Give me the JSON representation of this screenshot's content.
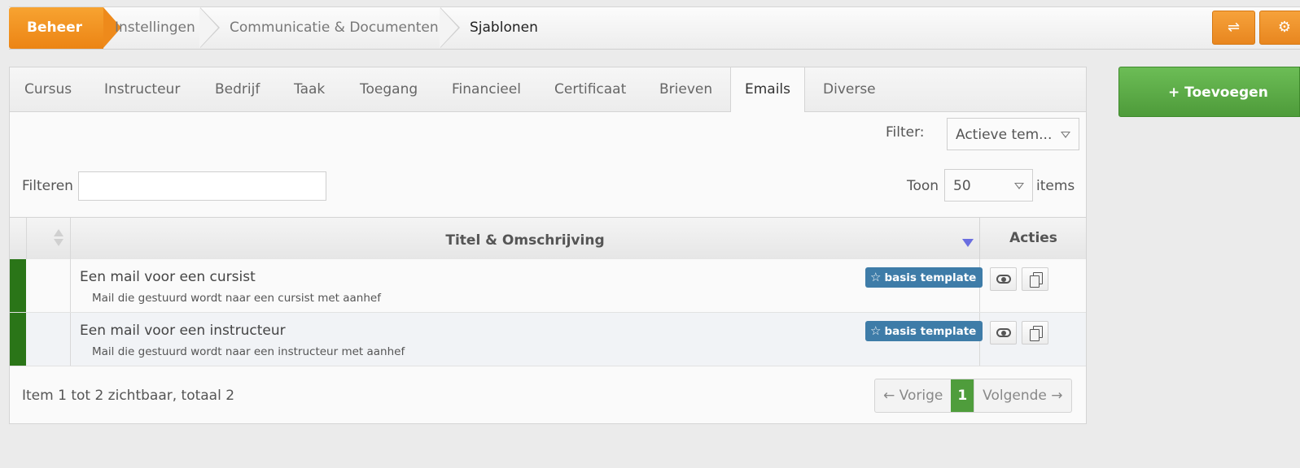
{
  "breadcrumb": {
    "items": [
      "Beheer",
      "Instellingen",
      "Communicatie & Documenten",
      "Sjablonen"
    ]
  },
  "tabs": [
    "Cursus",
    "Instructeur",
    "Bedrijf",
    "Taak",
    "Toegang",
    "Financieel",
    "Certificaat",
    "Brieven",
    "Emails",
    "Diverse"
  ],
  "active_tab": "Emails",
  "filter": {
    "label": "Filter:",
    "value": "Actieve tem..."
  },
  "search": {
    "label": "Filteren",
    "value": ""
  },
  "pagesize": {
    "label_before": "Toon",
    "value": "50",
    "label_after": "items"
  },
  "table": {
    "columns": {
      "title": "Titel & Omschrijving",
      "actions": "Acties"
    },
    "rows": [
      {
        "title": "Een mail voor een cursist",
        "description": "Mail die gestuurd wordt naar een cursist met aanhef",
        "badge": "basis template",
        "status_color": "#2a7518"
      },
      {
        "title": "Een mail voor een instructeur",
        "description": "Mail die gestuurd wordt naar een instructeur met aanhef",
        "badge": "basis template",
        "status_color": "#2a7518"
      }
    ]
  },
  "footer": {
    "summary": "Item 1 tot 2 zichtbaar, totaal 2"
  },
  "pagination": {
    "prev": "← Vorige",
    "current": "1",
    "next": "Volgende →"
  },
  "add_button": {
    "label": "+ Toevoegen"
  },
  "colors": {
    "accent_orange": "#ec8414",
    "accent_green": "#4e9b3a",
    "badge_blue": "#3e7ca8"
  }
}
